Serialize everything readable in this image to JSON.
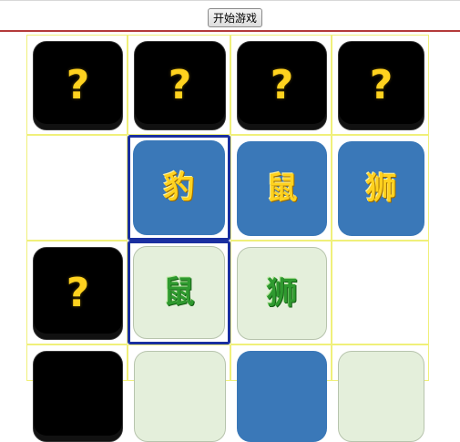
{
  "toolbar": {
    "start_label": "开始游戏"
  },
  "colors": {
    "header_line": "#b43a3a",
    "cell_border": "#f0f07a",
    "hidden_piece": "#000000",
    "blue_side": "#3a78b8",
    "green_side": "#e4efdb",
    "selected_border": "#1a2fa0"
  },
  "board": {
    "rows": [
      {
        "cells": [
          {
            "state": "hidden",
            "text": "?",
            "selected": false
          },
          {
            "state": "hidden",
            "text": "?",
            "selected": false
          },
          {
            "state": "hidden",
            "text": "?",
            "selected": false
          },
          {
            "state": "hidden",
            "text": "?",
            "selected": false
          }
        ]
      },
      {
        "cells": [
          {
            "state": "empty",
            "text": "",
            "selected": false
          },
          {
            "state": "blue",
            "text": "豹",
            "selected": true
          },
          {
            "state": "blue",
            "text": "鼠",
            "selected": false
          },
          {
            "state": "blue",
            "text": "狮",
            "selected": false
          }
        ]
      },
      {
        "cells": [
          {
            "state": "hidden",
            "text": "?",
            "selected": false
          },
          {
            "state": "green",
            "text": "鼠",
            "selected": true
          },
          {
            "state": "green",
            "text": "狮",
            "selected": false
          },
          {
            "state": "empty",
            "text": "",
            "selected": false
          }
        ]
      },
      {
        "cells": [
          {
            "state": "hidden",
            "text": "",
            "selected": false
          },
          {
            "state": "green",
            "text": "",
            "selected": false
          },
          {
            "state": "blue",
            "text": "",
            "selected": false
          },
          {
            "state": "green",
            "text": "",
            "selected": false
          }
        ]
      }
    ]
  }
}
